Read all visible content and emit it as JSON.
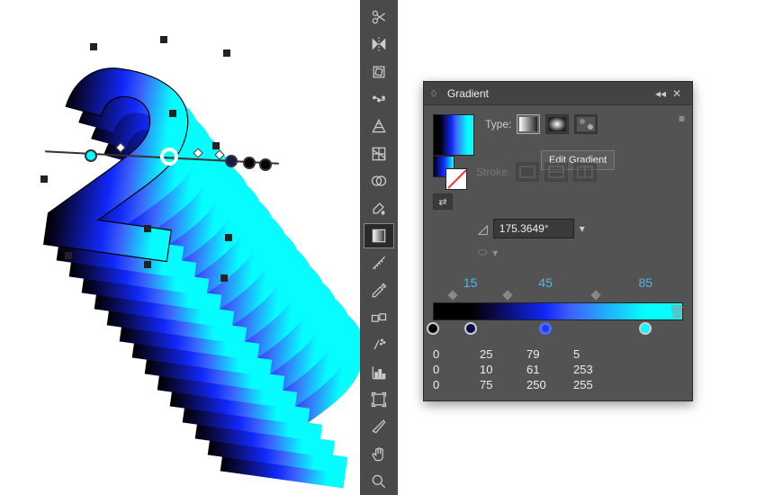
{
  "panel": {
    "title": "Gradient",
    "type_label": "Type:",
    "tooltip": "Edit Gradient",
    "stroke_label": "Stroke:",
    "angle_value": "175.3649°",
    "stop_positions": [
      0,
      15,
      45,
      85
    ],
    "midpoints": [
      8,
      30,
      65
    ],
    "stop_labels": [
      "15",
      "45",
      "85"
    ],
    "stops": [
      {
        "pos": 0,
        "color": "#000000",
        "r": 0,
        "g": 0,
        "b": 0
      },
      {
        "pos": 15,
        "color": "#0a0a4b",
        "r": 25,
        "g": 10,
        "b": 75
      },
      {
        "pos": 45,
        "color": "#4f3dfa",
        "r": 79,
        "g": 61,
        "b": 250
      },
      {
        "pos": 85,
        "color": "#05fdff",
        "r": 5,
        "g": 253,
        "b": 255
      }
    ]
  },
  "toolbar": {
    "tools": [
      "scissors",
      "reflect",
      "free-transform",
      "puppet-warp",
      "perspective",
      "mesh",
      "shape-builder",
      "live-paint",
      "gradient",
      "slice",
      "eyedropper",
      "blend",
      "symbol-sprayer",
      "column-graph",
      "artboard",
      "slice-select",
      "hand",
      "zoom"
    ]
  }
}
